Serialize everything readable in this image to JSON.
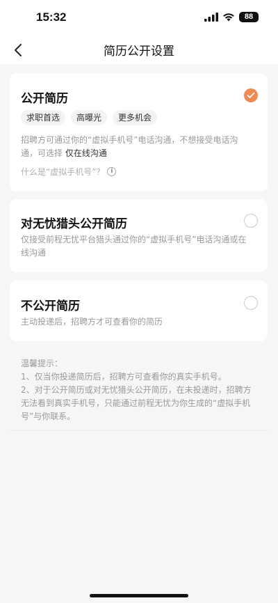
{
  "status": {
    "time": "15:32",
    "battery": "88"
  },
  "nav": {
    "title": "简历公开设置"
  },
  "options": [
    {
      "title": "公开简历",
      "selected": true,
      "tags": [
        "求职首选",
        "高曝光",
        "更多机会"
      ],
      "desc_prefix": "招聘方可通过你的“虚拟手机号”电话沟通，不想接受电话沟通，可选择",
      "desc_strong": " 仅在线沟通",
      "help": "什么是“虚拟手机号”？"
    },
    {
      "title": "对无忧猎头公开简历",
      "selected": false,
      "desc": "仅接受前程无忧平台猎头通过你的“虚拟手机号”电话沟通或在线沟通"
    },
    {
      "title": "不公开简历",
      "selected": false,
      "desc": "主动投递后，招聘方才可查看你的简历"
    }
  ],
  "tips": {
    "title": "温馨提示：",
    "items": [
      "1、仅当你投递简历后，招聘方可查看你的真实手机号。",
      "2、对于公开简历或对无忧猎头公开简历，在未投递时，招聘方无法看到真实手机号，只能通过前程无忧为你生成的“虚拟手机号”与你联系。"
    ]
  },
  "colors": {
    "accent": "#ee8a52"
  }
}
